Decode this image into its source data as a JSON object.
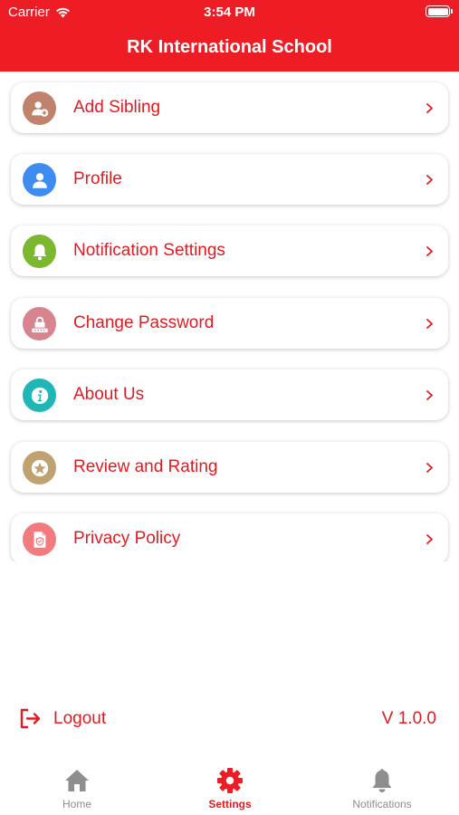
{
  "status_bar": {
    "carrier": "Carrier",
    "time": "3:54 PM"
  },
  "header": {
    "title": "RK International School"
  },
  "menu": [
    {
      "label": "Add Sibling",
      "icon": "add-user-icon",
      "color": "#c0826b"
    },
    {
      "label": "Profile",
      "icon": "user-icon",
      "color": "#3f8cf0"
    },
    {
      "label": "Notification Settings",
      "icon": "bell-icon",
      "color": "#7cb82f"
    },
    {
      "label": "Change Password",
      "icon": "lock-icon",
      "color": "#d8848f"
    },
    {
      "label": "About Us",
      "icon": "info-icon",
      "color": "#1fb6b8"
    },
    {
      "label": "Review and Rating",
      "icon": "star-icon",
      "color": "#c0a272"
    },
    {
      "label": "Privacy Policy",
      "icon": "document-shield-icon",
      "color": "#f27b80"
    }
  ],
  "footer": {
    "logout_label": "Logout",
    "version": "V 1.0.0"
  },
  "tabs": [
    {
      "label": "Home",
      "icon": "home-icon",
      "active": false
    },
    {
      "label": "Settings",
      "icon": "gear-icon",
      "active": true
    },
    {
      "label": "Notifications",
      "icon": "bell-icon",
      "active": false
    }
  ],
  "colors": {
    "brand": "#ee1c25",
    "text_accent": "#e01b22",
    "tab_inactive": "#8e8e8e"
  }
}
